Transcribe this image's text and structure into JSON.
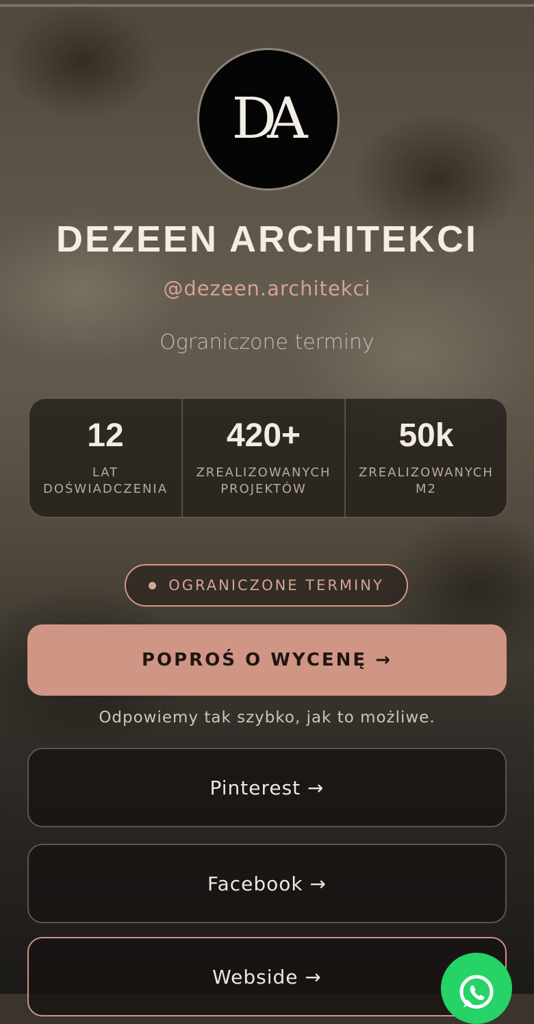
{
  "profile": {
    "logo_text": "DA",
    "name": "DEZEEN ARCHITEKCI",
    "handle": "@dezeen.architekci",
    "tagline": "Ograniczone terminy"
  },
  "stats": [
    {
      "value": "12",
      "label_line1": "LAT",
      "label_line2": "DOŚWIADCZENIA"
    },
    {
      "value": "420+",
      "label_line1": "ZREALIZOWANYCH",
      "label_line2": "PROJEKTÓW"
    },
    {
      "value": "50k",
      "label_line1": "ZREALIZOWANYCH",
      "label_line2": "M2"
    }
  ],
  "availability_badge": "OGRANICZONE TERMINY",
  "cta": {
    "label": "POPROŚ O WYCENĘ →",
    "note": "Odpowiemy tak szybko, jak to możliwe."
  },
  "links": [
    {
      "label": "Pinterest →"
    },
    {
      "label": "Facebook →"
    },
    {
      "label": "Webside →"
    }
  ],
  "colors": {
    "accent": "#cf9585",
    "whatsapp": "#25d366"
  },
  "floating": {
    "icon": "whatsapp-icon"
  }
}
